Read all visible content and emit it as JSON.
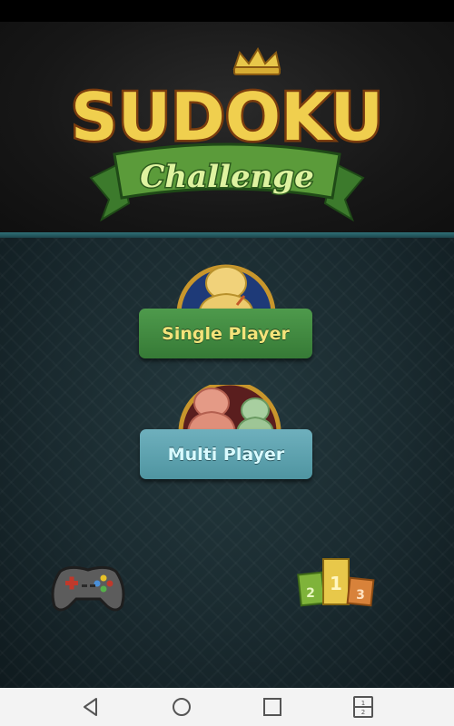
{
  "logo": {
    "title": "SUDOKU",
    "subtitle": "Challenge"
  },
  "menu": {
    "single_player_label": "Single Player",
    "multi_player_label": "Multi Player"
  },
  "bottom_icons": {
    "left": "gamepad-icon",
    "right": "leaderboard-podium-icon"
  },
  "podium": {
    "first": "1",
    "second": "2",
    "third": "3"
  },
  "nav": {
    "buttons": [
      "back-icon",
      "home-icon",
      "recents-icon",
      "split-screen-icon"
    ],
    "split_top": "1",
    "split_bottom": "2"
  },
  "colors": {
    "single_button": "#418b40",
    "multi_button": "#5fa3af",
    "header_divider": "#2f6f76",
    "background": "#1a2a2f"
  }
}
